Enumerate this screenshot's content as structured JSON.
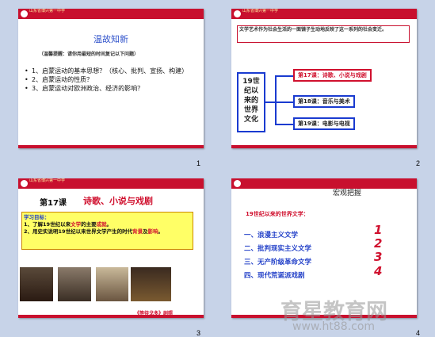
{
  "slides": [
    {
      "number": "1",
      "header": "山东省博兴第一中学",
      "title": "温故知新",
      "hint": "（温馨提醒：请你用最短的时间复记以下问题）",
      "items": [
        "1、启蒙运动的基本思想？（核心、批判、宣扬、构建）",
        "2、启蒙运动的性质？",
        "3、启蒙运动对欧洲政治、经济的影响？"
      ]
    },
    {
      "number": "2",
      "header": "山东省博兴第一中学",
      "intro": "文学艺术作为社会生活的一面镜子生动地反映了这一系列的社会变迁。",
      "root": [
        "19世",
        "纪以",
        "来的",
        "世界",
        "文化"
      ],
      "branches": [
        "第17课：诗歌、小说与戏剧",
        "第18课：音乐与美术",
        "第19课：电影与电视"
      ]
    },
    {
      "number": "3",
      "header": "山东省博兴第一中学",
      "lesson": "第17课",
      "lesson_title": "诗歌、小说与戏剧",
      "goals_title": "学习目标：",
      "goal1_pre": "1、了解19世纪以来",
      "goal1_mid": "文学",
      "goal1_post": "的主要",
      "goal1_red": "成就",
      "goal1_end": "。",
      "goal2_pre": "2、用史实说明19世纪以来世界文学产生的时代",
      "goal2_red1": "背景",
      "goal2_and": "及",
      "goal2_red2": "影响",
      "goal2_end": "。",
      "caption": "《等待戈多》剧照"
    },
    {
      "number": "4",
      "title": "宏观把握",
      "subtitle": "19世纪以来的世界文学：",
      "items": [
        "一、浪漫主义文学",
        "二、批判现实主义文学",
        "三、无产阶级革命文学",
        "四、现代荒诞派戏剧"
      ],
      "numerals": [
        "1",
        "2",
        "3",
        "4"
      ]
    }
  ],
  "watermark": {
    "main": "育星教育网",
    "url": "www.ht88.com"
  }
}
